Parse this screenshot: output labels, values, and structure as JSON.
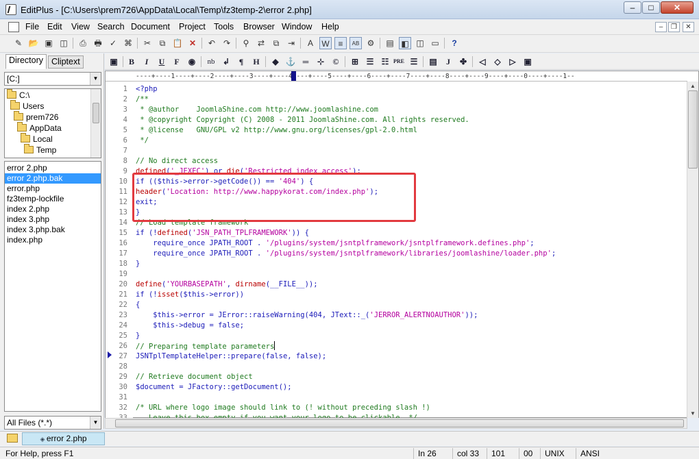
{
  "window": {
    "title": "EditPlus - [C:\\Users\\prem726\\AppData\\Local\\Temp\\fz3temp-2\\error 2.php]",
    "min": "–",
    "max": "□",
    "close": "✕"
  },
  "menu": [
    "File",
    "Edit",
    "View",
    "Search",
    "Document",
    "Project",
    "Tools",
    "Browser",
    "Window",
    "Help"
  ],
  "mdi": {
    "min": "–",
    "restore": "❐",
    "close": "✕"
  },
  "toolbar2_labels": {
    "b": "B",
    "i": "I",
    "u": "U",
    "f": "F",
    "nb": "nb",
    "h": "H",
    "pre": "PRE",
    "j": "J"
  },
  "left": {
    "tabs": [
      "Directory",
      "Cliptext"
    ],
    "drive": "[C:]",
    "tree": [
      "C:\\",
      "Users",
      "prem726",
      "AppData",
      "Local",
      "Temp"
    ],
    "files": [
      "error 2.php",
      "error 2.php.bak",
      "error.php",
      "fz3temp-lockfile",
      "index 2.php",
      "index 3.php",
      "index 3.php.bak",
      "index.php"
    ],
    "selected_file_index": 1,
    "filter": "All Files (*.*)"
  },
  "ruler": "----+----1----+----2----+----3----+----4----+----5----+----6----+----7----+----8----+----9----+----0----+----1--",
  "code": {
    "lines": [
      {
        "n": "1",
        "parts": [
          [
            "kw",
            "<?php"
          ]
        ]
      },
      {
        "n": "2",
        "parts": [
          [
            "cm",
            "/**"
          ]
        ]
      },
      {
        "n": "3",
        "parts": [
          [
            "cm",
            " * @author    JoomlaShine.com http://www.joomlashine.com"
          ]
        ]
      },
      {
        "n": "4",
        "parts": [
          [
            "cm",
            " * @copyright Copyright (C) 2008 - 2011 JoomlaShine.com. All rights reserved."
          ]
        ]
      },
      {
        "n": "5",
        "parts": [
          [
            "cm",
            " * @license   GNU/GPL v2 http://www.gnu.org/licenses/gpl-2.0.html"
          ]
        ]
      },
      {
        "n": "6",
        "parts": [
          [
            "cm",
            " */"
          ]
        ]
      },
      {
        "n": "7",
        "parts": []
      },
      {
        "n": "8",
        "parts": [
          [
            "cm",
            "// No direct access"
          ]
        ]
      },
      {
        "n": "9",
        "parts": [
          [
            "red",
            "defined"
          ],
          [
            "plain",
            "("
          ],
          [
            "str",
            "'_JEXEC'"
          ],
          [
            "plain",
            ") or "
          ],
          [
            "red",
            "die"
          ],
          [
            "plain",
            "("
          ],
          [
            "str",
            "'Restricted index access'"
          ],
          [
            "plain",
            ");"
          ]
        ]
      },
      {
        "n": "10",
        "parts": [
          [
            "kw",
            "if"
          ],
          [
            "plain",
            " (($this->error->getCode()) == "
          ],
          [
            "str",
            "'404'"
          ],
          [
            "plain",
            ") {"
          ]
        ]
      },
      {
        "n": "11",
        "parts": [
          [
            "red",
            "header"
          ],
          [
            "plain",
            "("
          ],
          [
            "str",
            "'Location: http://www.happykorat.com/index.php'"
          ],
          [
            "plain",
            ");"
          ]
        ]
      },
      {
        "n": "12",
        "parts": [
          [
            "kw",
            "exit"
          ],
          [
            "plain",
            ";"
          ]
        ]
      },
      {
        "n": "13",
        "parts": [
          [
            "plain",
            "}"
          ]
        ]
      },
      {
        "n": "14",
        "parts": [
          [
            "cm",
            "// Load template framework"
          ]
        ]
      },
      {
        "n": "15",
        "parts": [
          [
            "kw",
            "if"
          ],
          [
            "plain",
            " (!"
          ],
          [
            "red",
            "defined"
          ],
          [
            "plain",
            "("
          ],
          [
            "str",
            "'JSN_PATH_TPLFRAMEWORK'"
          ],
          [
            "plain",
            ")) {"
          ]
        ]
      },
      {
        "n": "16",
        "parts": [
          [
            "plain",
            "    "
          ],
          [
            "kw",
            "require_once"
          ],
          [
            "plain",
            " JPATH_ROOT . "
          ],
          [
            "str",
            "'/plugins/system/jsntplframework/jsntplframework.defines.php'"
          ],
          [
            "plain",
            ";"
          ]
        ]
      },
      {
        "n": "17",
        "parts": [
          [
            "plain",
            "    "
          ],
          [
            "kw",
            "require_once"
          ],
          [
            "plain",
            " JPATH_ROOT . "
          ],
          [
            "str",
            "'/plugins/system/jsntplframework/libraries/joomlashine/loader.php'"
          ],
          [
            "plain",
            ";"
          ]
        ]
      },
      {
        "n": "18",
        "parts": [
          [
            "plain",
            "}"
          ]
        ]
      },
      {
        "n": "19",
        "parts": []
      },
      {
        "n": "20",
        "parts": [
          [
            "red",
            "define"
          ],
          [
            "plain",
            "("
          ],
          [
            "str",
            "'YOURBASEPATH'"
          ],
          [
            "plain",
            ", "
          ],
          [
            "red",
            "dirname"
          ],
          [
            "plain",
            "(__FILE__));"
          ]
        ]
      },
      {
        "n": "21",
        "parts": [
          [
            "kw",
            "if"
          ],
          [
            "plain",
            " (!"
          ],
          [
            "red",
            "isset"
          ],
          [
            "plain",
            "($this->error))"
          ]
        ]
      },
      {
        "n": "22",
        "parts": [
          [
            "plain",
            "{"
          ]
        ]
      },
      {
        "n": "23",
        "parts": [
          [
            "plain",
            "    $this->error = JError::raiseWarning(404, JText::_("
          ],
          [
            "str",
            "'JERROR_ALERTNOAUTHOR'"
          ],
          [
            "plain",
            "));"
          ]
        ]
      },
      {
        "n": "24",
        "parts": [
          [
            "plain",
            "    $this->debug = "
          ],
          [
            "kw",
            "false"
          ],
          [
            "plain",
            ";"
          ]
        ]
      },
      {
        "n": "25",
        "parts": [
          [
            "plain",
            "}"
          ]
        ]
      },
      {
        "n": "26",
        "parts": [
          [
            "cm",
            "// Preparing template parameters"
          ]
        ]
      },
      {
        "n": "27",
        "parts": [
          [
            "plain",
            "JSNTplTemplateHelper::prepare("
          ],
          [
            "kw",
            "false"
          ],
          [
            "plain",
            ", "
          ],
          [
            "kw",
            "false"
          ],
          [
            "plain",
            ");"
          ]
        ]
      },
      {
        "n": "28",
        "parts": []
      },
      {
        "n": "29",
        "parts": [
          [
            "cm",
            "// Retrieve document object"
          ]
        ]
      },
      {
        "n": "30",
        "parts": [
          [
            "plain",
            "$document = JFactory::getDocument();"
          ]
        ]
      },
      {
        "n": "31",
        "parts": []
      },
      {
        "n": "32",
        "parts": [
          [
            "cm",
            "/* URL where logo image should link to (! without preceding slash !)"
          ]
        ]
      },
      {
        "n": "33",
        "parts": [
          [
            "cm",
            "   Leave this box empty if you want your logo to be clickable. */"
          ]
        ]
      }
    ]
  },
  "doc_tab": "error 2.php",
  "status": {
    "help": "For Help, press F1",
    "line": "In 26",
    "col": "col 33",
    "count": "101",
    "mode": "00",
    "eol": "UNIX",
    "enc": "ANSI"
  }
}
